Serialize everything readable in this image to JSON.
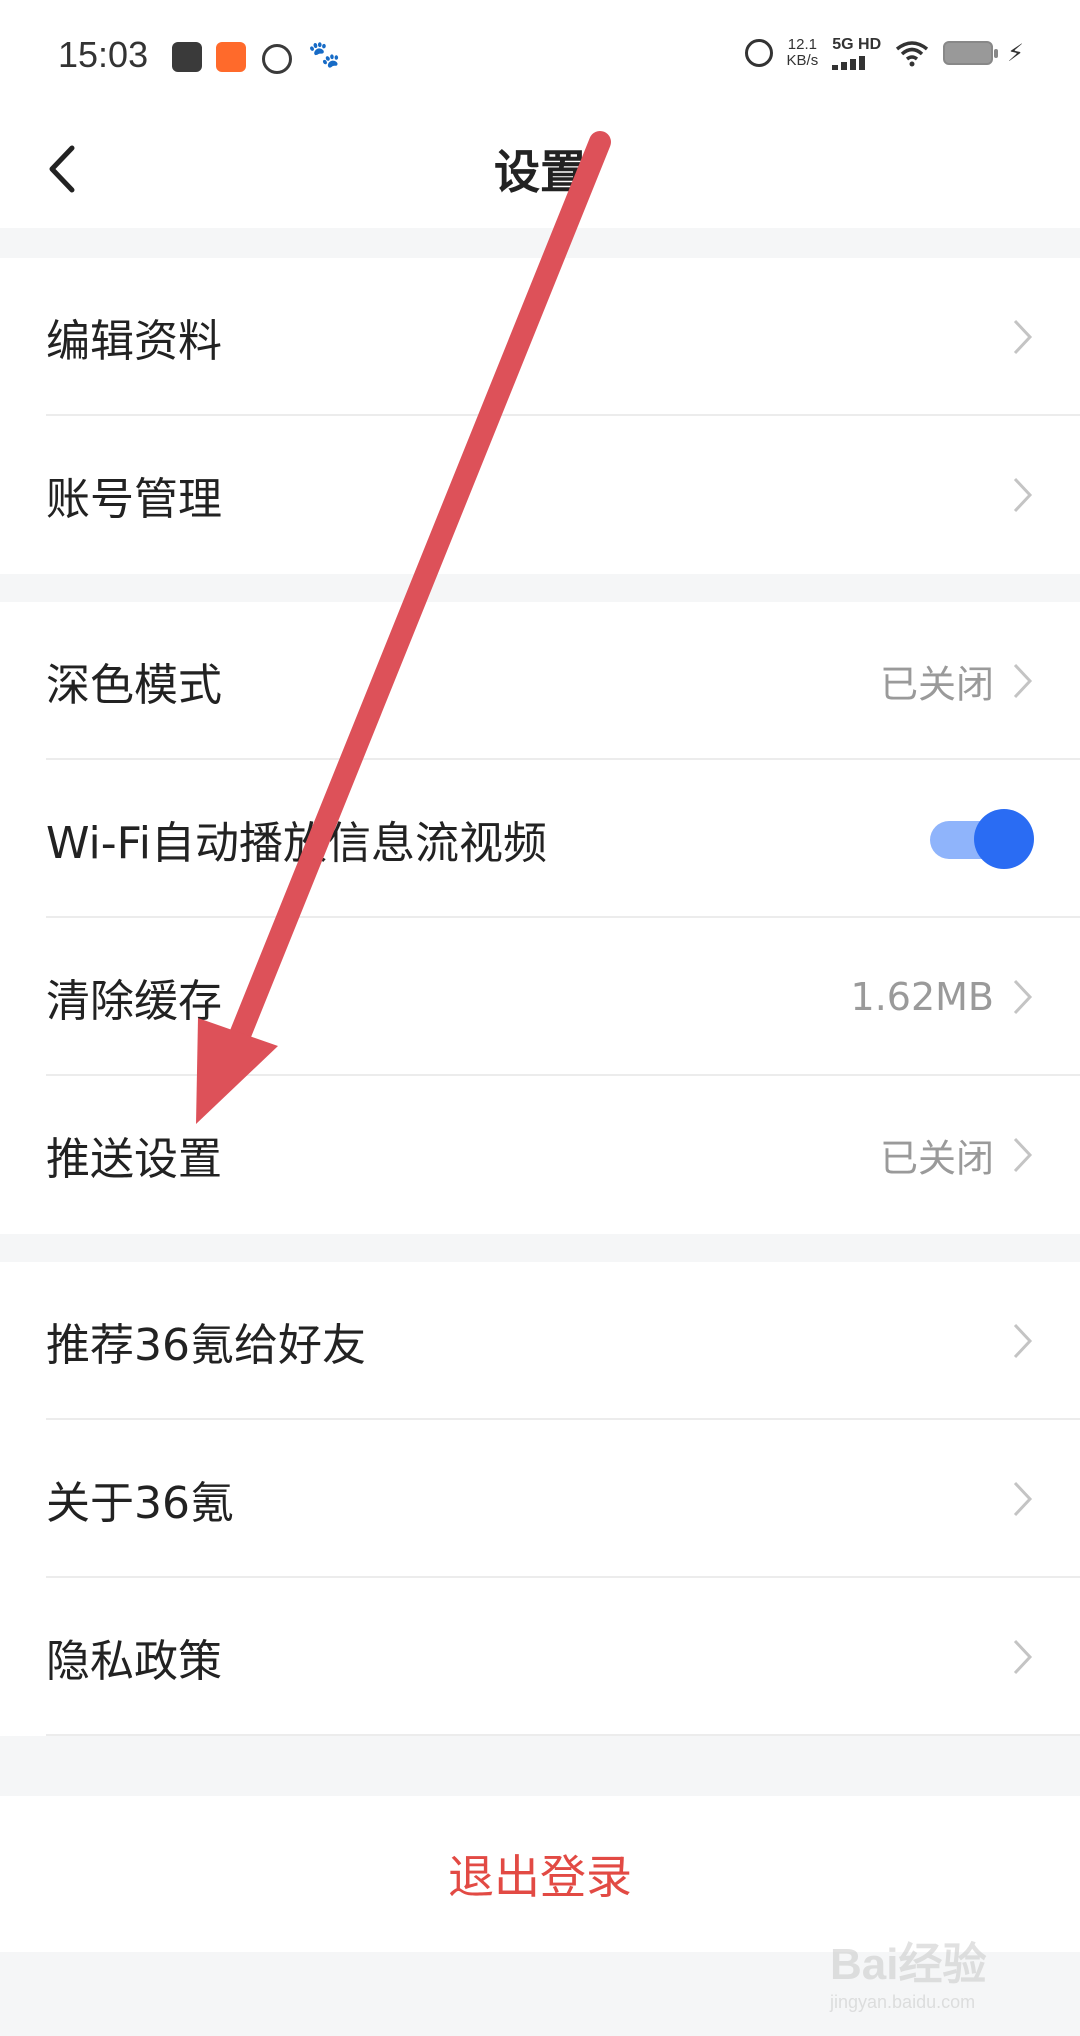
{
  "status_bar": {
    "time": "15:03",
    "net_speed_value": "12.1",
    "net_speed_unit": "KB/s",
    "network": "5G HD"
  },
  "nav": {
    "title": "设置",
    "back_icon": "chevron-left-icon"
  },
  "groups": [
    {
      "items": [
        {
          "label": "编辑资料",
          "value": "",
          "control": "chevron"
        },
        {
          "label": "账号管理",
          "value": "",
          "control": "chevron"
        }
      ]
    },
    {
      "items": [
        {
          "label": "深色模式",
          "value": "已关闭",
          "control": "chevron"
        },
        {
          "label": "Wi-Fi自动播放信息流视频",
          "value": "",
          "control": "toggle",
          "toggle_on": true
        },
        {
          "label": "清除缓存",
          "value": "1.62MB",
          "control": "chevron"
        },
        {
          "label": "推送设置",
          "value": "已关闭",
          "control": "chevron"
        }
      ]
    },
    {
      "items": [
        {
          "label": "推荐36氪给好友",
          "value": "",
          "control": "chevron"
        },
        {
          "label": "关于36氪",
          "value": "",
          "control": "chevron"
        },
        {
          "label": "隐私政策",
          "value": "",
          "control": "chevron"
        }
      ]
    }
  ],
  "logout_label": "退出登录",
  "watermark": {
    "brand": "Bai经验",
    "domain": "jingyan.baidu.com"
  },
  "colors": {
    "accent": "#2a6cf3",
    "danger": "#e24a44",
    "annotation_arrow": "#dd5159"
  }
}
